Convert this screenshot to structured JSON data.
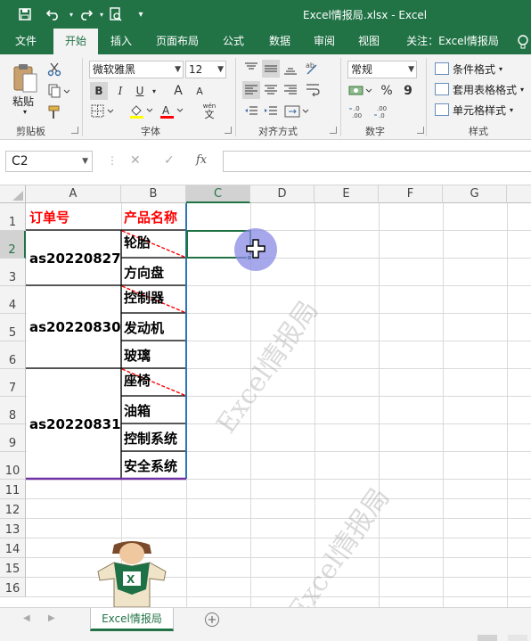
{
  "titlebar": {
    "title": "Excel情报局.xlsx  -  Excel",
    "save_icon": "save-icon",
    "undo_icon": "undo-icon",
    "redo_icon": "redo-icon",
    "preview_icon": "print-preview-icon"
  },
  "tabs": [
    "文件",
    "开始",
    "插入",
    "页面布局",
    "公式",
    "数据",
    "审阅",
    "视图",
    "关注：Excel情报局"
  ],
  "active_tab": "开始",
  "ribbon": {
    "clipboard": {
      "paste_label": "粘贴",
      "group_label": "剪贴板"
    },
    "font": {
      "font_name": "微软雅黑",
      "font_size": "12",
      "bold": "B",
      "italic": "I",
      "underline": "U",
      "grow": "A",
      "shrink": "A",
      "wen": "文",
      "group_label": "字体"
    },
    "alignment": {
      "group_label": "对齐方式"
    },
    "number": {
      "format": "常规",
      "percent": "%",
      "comma": "9",
      "group_label": "数字"
    },
    "styles": {
      "conditional": "条件格式",
      "table": "套用表格格式",
      "cell": "单元格样式",
      "group_label": "样式"
    }
  },
  "formula_bar": {
    "name_box": "C2",
    "cancel": "✕",
    "enter": "✓",
    "fx": "fx",
    "value": ""
  },
  "columns": [
    "A",
    "B",
    "C",
    "D",
    "E",
    "F",
    "G"
  ],
  "selected_column": "C",
  "rows": [
    "1",
    "2",
    "3",
    "4",
    "5",
    "6",
    "7",
    "8",
    "9",
    "10",
    "11",
    "12",
    "13",
    "14",
    "15",
    "16"
  ],
  "selected_row": "2",
  "cells": {
    "A1": "订单号",
    "B1": "产品名称",
    "A_group1": "as20220827",
    "A_group2": "as20220830",
    "A_group3": "as20220831",
    "B2": "轮胎",
    "B3": "方向盘",
    "B4": "控制器",
    "B5": "发动机",
    "B6": "玻璃",
    "B7": "座椅",
    "B8": "油箱",
    "B9": "控制系统",
    "B10": "安全系统"
  },
  "watermark": "Excel情报局",
  "sheet_tab": "Excel情报局",
  "add_sheet_icon": "plus-icon",
  "colors": {
    "excel_green": "#217346",
    "header_red": "#ff0000",
    "pointer": "#8a8ae6",
    "border_blue": "#2e75b6",
    "border_purple": "#7030a0"
  }
}
